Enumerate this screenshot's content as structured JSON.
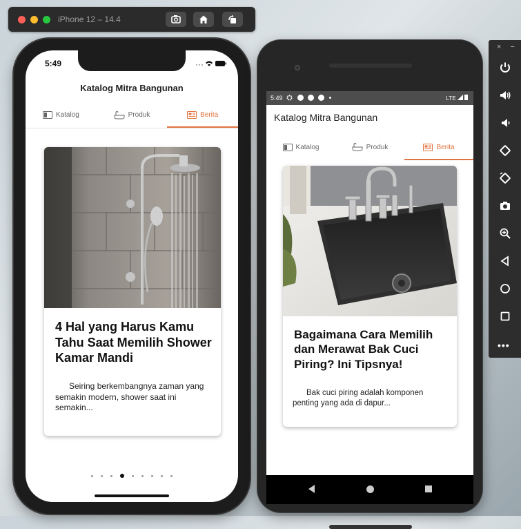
{
  "simulator": {
    "title": "iPhone 12 – 14.4",
    "buttons": [
      "screenshot-icon",
      "home-icon",
      "rotate-icon"
    ]
  },
  "iphone": {
    "status_time": "5:49",
    "app_title": "Katalog Mitra Bangunan",
    "tabs": [
      {
        "label": "Katalog",
        "icon": "catalog-icon",
        "active": false
      },
      {
        "label": "Produk",
        "icon": "bathtub-icon",
        "active": false
      },
      {
        "label": "Berita",
        "icon": "news-icon",
        "active": true
      }
    ],
    "card": {
      "image": "shower-photo",
      "title": "4 Hal yang Harus Kamu Tahu Saat Memilih Shower Kamar Mandi",
      "excerpt": "Seiring berkembangnya zaman yang semakin modern, shower saat ini semakin..."
    },
    "pager": {
      "count": 9,
      "active_index": 3
    }
  },
  "android": {
    "status_time": "5:49",
    "status_network": "LTE",
    "app_title": "Katalog Mitra Bangunan",
    "tabs": [
      {
        "label": "Katalog",
        "icon": "catalog-icon",
        "active": false
      },
      {
        "label": "Produk",
        "icon": "bathtub-icon",
        "active": false
      },
      {
        "label": "Berita",
        "icon": "news-icon",
        "active": true
      }
    ],
    "card": {
      "image": "kitchen-sink-photo",
      "title": "Bagaimana Cara Memilih dan Merawat Bak Cuci Piring? Ini Tipsnya!",
      "excerpt": "Bak cuci piring adalah komponen penting yang ada di dapur..."
    }
  },
  "emulator_toolbar": {
    "close": "×",
    "minimize": "−",
    "more": "•••",
    "buttons": [
      "power-icon",
      "volume-up-icon",
      "volume-down-icon",
      "rotate-left-icon",
      "rotate-right-icon",
      "camera-icon",
      "zoom-icon",
      "back-icon",
      "home-icon",
      "overview-icon"
    ]
  },
  "colors": {
    "accent": "#e0733f",
    "text": "#111111"
  }
}
